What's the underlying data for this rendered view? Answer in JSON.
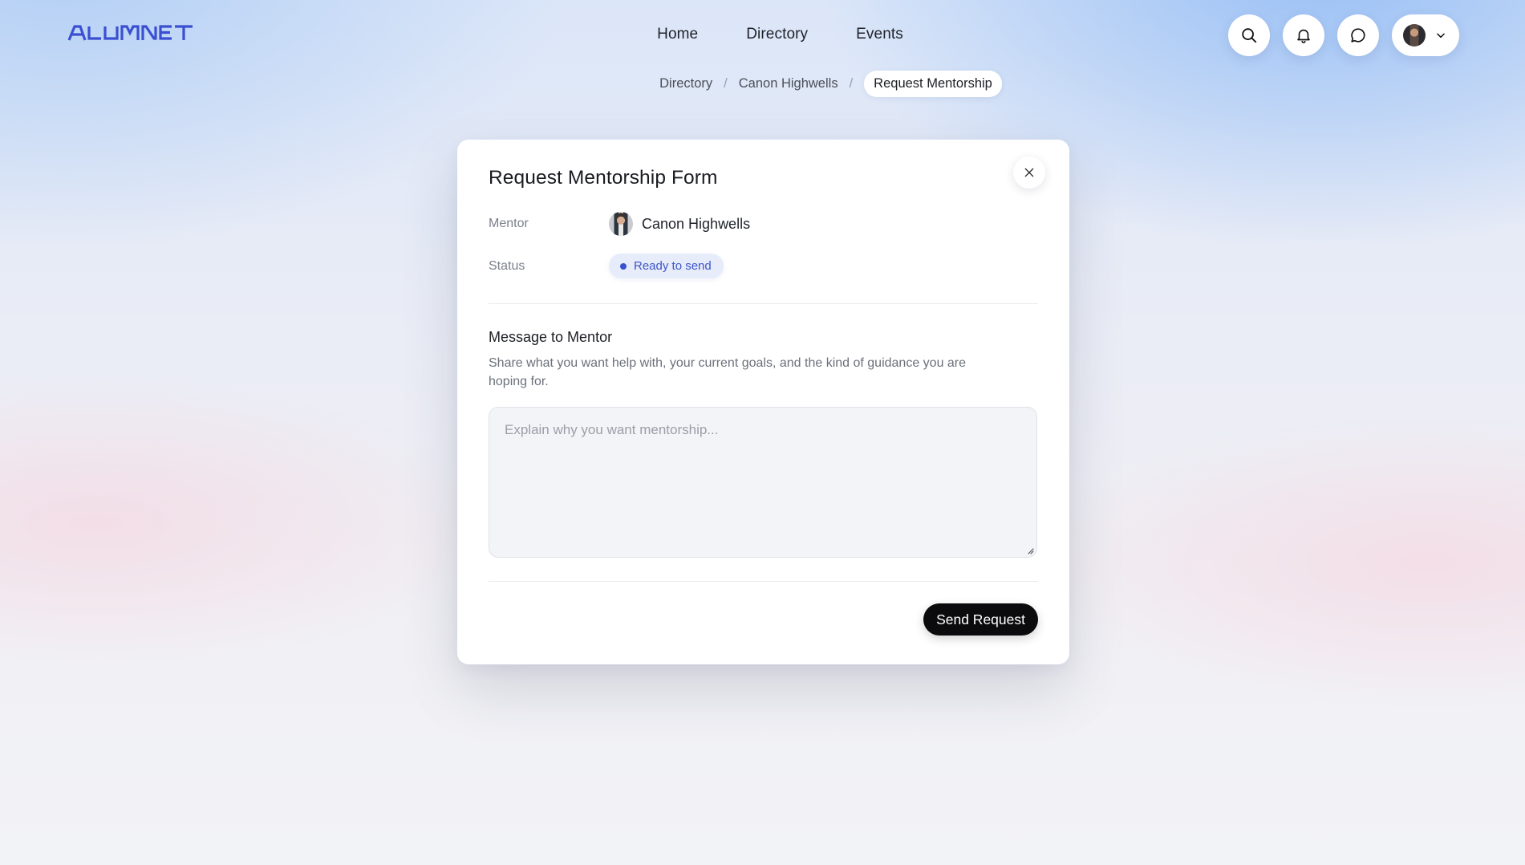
{
  "brand": {
    "logo_text": "ALUMNET",
    "logo_color": "#3b4fd1"
  },
  "nav": {
    "items": [
      "Home",
      "Directory",
      "Events"
    ]
  },
  "top_actions": {
    "icons": [
      "search-icon",
      "bell-icon",
      "chat-icon",
      "avatar",
      "chevron-down-icon"
    ]
  },
  "breadcrumb": {
    "items": [
      "Directory",
      "Canon Highwells",
      "Request Mentorship"
    ],
    "separator": "/"
  },
  "modal": {
    "title": "Request Mentorship Form",
    "mentor_label": "Mentor",
    "mentor_name": "Canon Highwells",
    "status_label": "Status",
    "status_value": "Ready to send",
    "status_color": "#3a50d0",
    "message_title": "Message to Mentor",
    "message_help": "Share what you want help with, your current goals, and the kind of guidance you are hoping for.",
    "message_placeholder": "Explain why you want mentorship...",
    "message_value": "",
    "send_label": "Send Request"
  }
}
